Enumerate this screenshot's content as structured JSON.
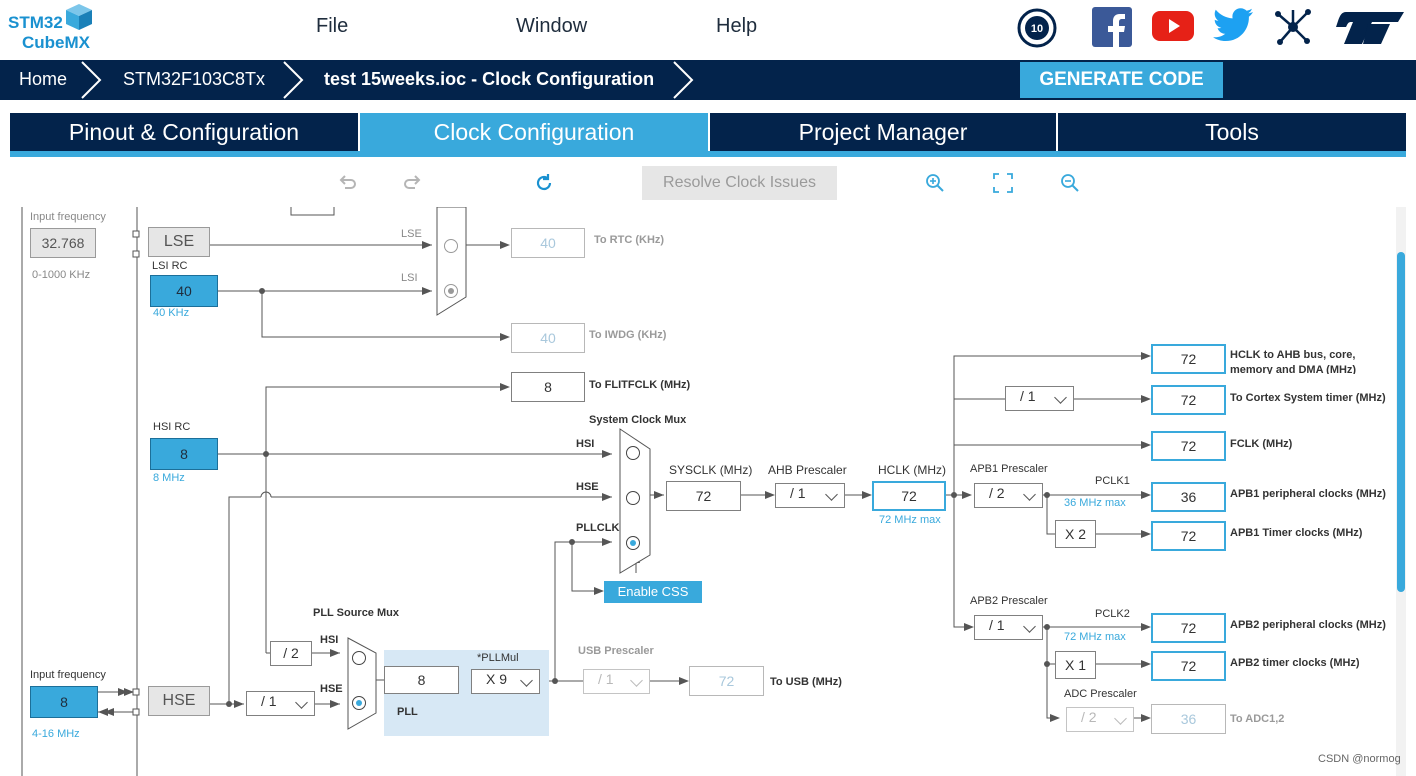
{
  "brand": {
    "line1": "STM32",
    "line2": "CubeMX"
  },
  "menu": [
    "File",
    "Window",
    "Help"
  ],
  "social_icons": [
    "anniversary-badge-icon",
    "facebook-icon",
    "youtube-icon",
    "twitter-icon",
    "network-icon",
    "st-logo-icon"
  ],
  "breadcrumb": [
    "Home",
    "STM32F103C8Tx",
    "test 15weeks.ioc - Clock Configuration"
  ],
  "generate_label": "GENERATE CODE",
  "tabs": [
    "Pinout & Configuration",
    "Clock Configuration",
    "Project Manager",
    "Tools"
  ],
  "toolbar": {
    "resolve": "Resolve Clock Issues",
    "icons": [
      "undo-icon",
      "redo-icon",
      "reset-icon",
      "zoom-in-icon",
      "fit-screen-icon",
      "zoom-out-icon"
    ]
  },
  "lse_section": {
    "input_freq_label": "Input frequency",
    "input_freq": "32.768",
    "range": "0-1000 KHz",
    "lse": "LSE",
    "lsi_rc": "LSI RC",
    "lsi_value": "40",
    "lsi_unit": "40 KHz",
    "mux_lse": "LSE",
    "mux_lsi": "LSI",
    "rtc_value": "40",
    "rtc_label": "To RTC (KHz)",
    "iwdg_value": "40",
    "iwdg_label": "To IWDG (KHz)"
  },
  "hsi": {
    "label": "HSI RC",
    "value": "8",
    "unit": "8 MHz"
  },
  "flitf": {
    "value": "8",
    "label": "To FLITFCLK (MHz)"
  },
  "sysmux": {
    "title": "System Clock Mux",
    "hsi": "HSI",
    "hse": "HSE",
    "pllclk": "PLLCLK",
    "css": "Enable CSS"
  },
  "sysclk": {
    "label": "SYSCLK (MHz)",
    "value": "72"
  },
  "ahb": {
    "label": "AHB Prescaler",
    "value": "/ 1"
  },
  "hclk": {
    "label": "HCLK (MHz)",
    "value": "72",
    "max": "72 MHz max"
  },
  "apb1": {
    "label": "APB1 Prescaler",
    "value": "/ 2",
    "pclk": "PCLK1",
    "max": "36 MHz max",
    "mult": "X 2"
  },
  "apb2": {
    "label": "APB2 Prescaler",
    "value": "/ 1",
    "pclk": "PCLK2",
    "max": "72 MHz max",
    "mult": "X 1"
  },
  "adc": {
    "label": "ADC Prescaler",
    "value": "/ 2",
    "out": "36",
    "out_label": "To ADC1,2"
  },
  "cortex_div": "/ 1",
  "outputs": [
    {
      "value": "72",
      "label": "HCLK to AHB bus, core, memory and DMA (MHz)"
    },
    {
      "value": "72",
      "label": "To Cortex System timer (MHz)"
    },
    {
      "value": "72",
      "label": "FCLK (MHz)"
    },
    {
      "value": "36",
      "label": "APB1 peripheral clocks (MHz)"
    },
    {
      "value": "72",
      "label": "APB1 Timer clocks (MHz)"
    },
    {
      "value": "72",
      "label": "APB2 peripheral clocks (MHz)"
    },
    {
      "value": "72",
      "label": "APB2 timer clocks (MHz)"
    }
  ],
  "hse": {
    "input_freq_label": "Input frequency",
    "input_freq": "8",
    "range": "4-16 MHz",
    "label": "HSE",
    "div": "/ 1"
  },
  "pllsrc": {
    "title": "PLL Source Mux",
    "hsi": "HSI",
    "hse": "HSE",
    "div2": "/ 2"
  },
  "pll": {
    "value": "8",
    "mul_label": "*PLLMul",
    "mul": "X 9",
    "label": "PLL"
  },
  "usb": {
    "label": "USB Prescaler",
    "value": "/ 1",
    "out": "72",
    "out_label": "To USB (MHz)"
  },
  "watermark": "CSDN @normog"
}
